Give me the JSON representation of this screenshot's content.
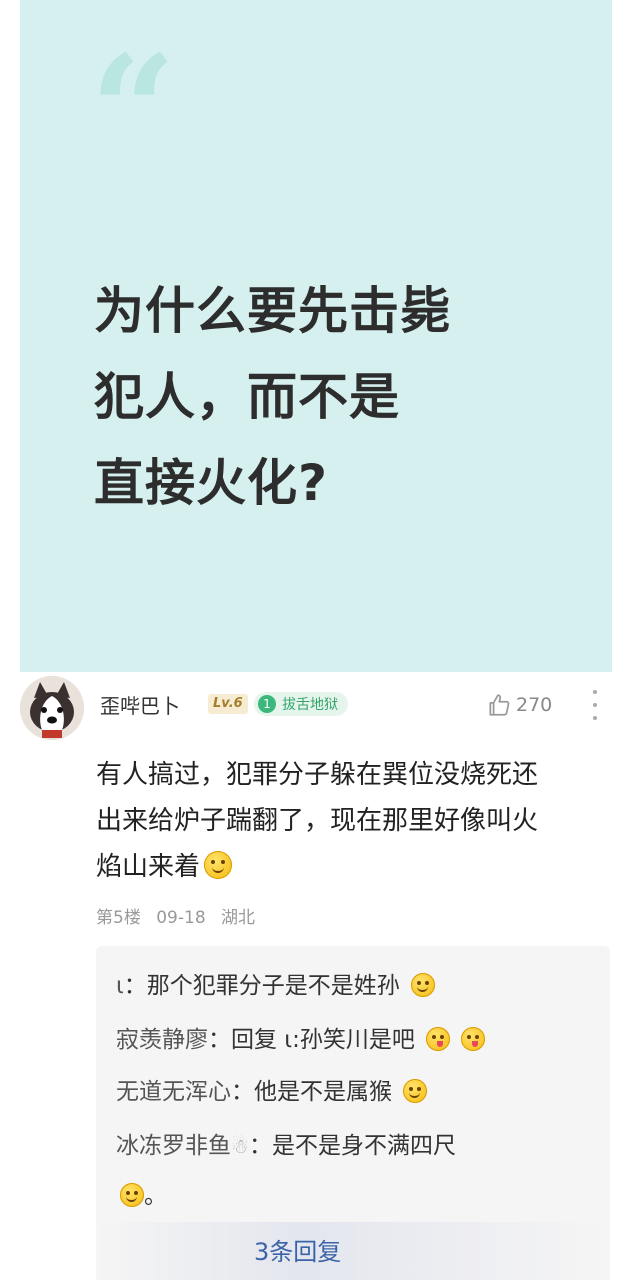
{
  "post": {
    "question_lines": [
      "为什么要先击毙",
      "犯人，而不是",
      "直接火化?"
    ]
  },
  "comment": {
    "username": "歪哔巴卜",
    "level": "Lv.6",
    "title_badge_num": "1",
    "title_badge": "拔舌地狱",
    "likes": "270",
    "text_lines": [
      "有人搞过，犯罪分子躲在巽位没烧死还",
      "出来给炉子踹翻了，现在那里好像叫火",
      "焰山来着"
    ],
    "floor": "第5楼",
    "date": "09-18",
    "location": "湖北"
  },
  "replies": [
    {
      "name": "ι",
      "sep": "：",
      "text": "那个犯罪分子是不是姓孙",
      "emojis": [
        "smile"
      ]
    },
    {
      "name": "寂羡静廖",
      "sep": "：",
      "text": "回复 ι:孙笑川是吧",
      "emojis": [
        "tongue",
        "tongue"
      ]
    },
    {
      "name": "无道无浑心",
      "sep": "：",
      "text": "他是不是属猴",
      "emojis": [
        "smile"
      ]
    },
    {
      "name": "冰冻罗非鱼",
      "sep": "：",
      "text": "是不是身不满四尺",
      "emojis": []
    },
    {
      "name": "",
      "sep": "",
      "text": "。",
      "emojis": [
        "smile"
      ]
    }
  ],
  "more_replies_label": "3条回复",
  "icons": {
    "quote": "quote-mark-icon",
    "like": "thumbs-up-icon",
    "more": "more-vertical-icon",
    "snowman": "snowman-icon"
  },
  "colors": {
    "card_bg": "#d5f0ee",
    "link_blue": "#3b64a8",
    "badge_green": "#3ab77a"
  }
}
